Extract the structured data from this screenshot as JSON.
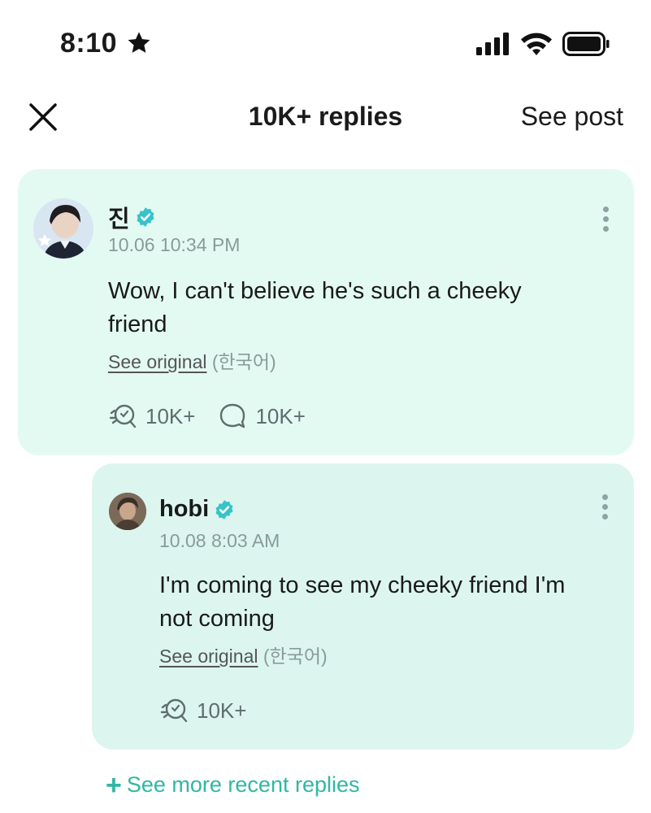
{
  "status_bar": {
    "time": "8:10"
  },
  "header": {
    "title": "10K+ replies",
    "see_post": "See post"
  },
  "main_comment": {
    "username": "진",
    "timestamp": "10.06 10:34 PM",
    "text_line1": "Wow, I can't believe he's such a cheeky",
    "text_line2": "friend",
    "see_original": "See original",
    "language": "(한국어)",
    "reaction_count": "10K+",
    "reply_count": "10K+"
  },
  "reply": {
    "username": "hobi",
    "timestamp": "10.08 8:03 AM",
    "text_line1": "I'm coming to see my cheeky friend I'm",
    "text_line2": "not coming",
    "see_original": "See original",
    "language": "(한국어)",
    "reaction_count": "10K+"
  },
  "see_more": {
    "plus": "+",
    "label": "See more recent replies"
  },
  "colors": {
    "accent": "#2fb7a3",
    "verified": "#36c3c9",
    "card_main": "#e3faf3",
    "card_reply": "#dcf6ef"
  },
  "icons": [
    "star-icon",
    "signal-icon",
    "wifi-icon",
    "battery-icon",
    "close-icon",
    "verified-icon",
    "more-icon",
    "reaction-icon",
    "comment-icon",
    "plus-icon"
  ]
}
